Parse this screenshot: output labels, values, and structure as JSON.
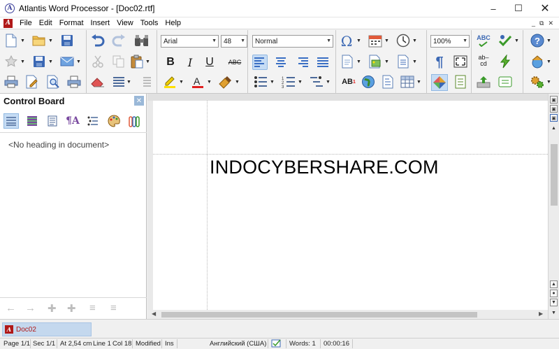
{
  "window": {
    "title": "Atlantis Word Processor - [Doc02.rtf]",
    "app_icon": "atlantis-logo-icon",
    "controls": {
      "minimize": "–",
      "maximize": "☐",
      "close": "✕"
    }
  },
  "menubar": {
    "items": [
      "File",
      "Edit",
      "Format",
      "Insert",
      "View",
      "Tools",
      "Help"
    ],
    "doc_icon_letter": "A",
    "mdi_controls": {
      "minimize": "_",
      "restore": "⧉",
      "close": "✕"
    }
  },
  "toolbar": {
    "font_name": "Arial",
    "font_size": "48",
    "style": "Normal",
    "zoom": "100%",
    "bold": "B",
    "italic": "I",
    "underline": "U",
    "strikethrough": "ABC",
    "omega": "Ω",
    "pilcrow": "¶",
    "spell": "ABC",
    "abcd_top": "ab–",
    "abcd_bottom": "cd",
    "superscript_label": "AB",
    "superscript_mark": "1",
    "icons": [
      "new-doc-icon",
      "open-folder-icon",
      "save-icon",
      "favorites-icon",
      "save-as-icon",
      "email-icon",
      "print-icon",
      "edit-doc-icon",
      "print-preview-icon",
      "undo-icon",
      "redo-icon",
      "find-icon",
      "cut-icon",
      "copy-icon",
      "paste-icon",
      "eraser-icon",
      "justify-icon",
      "indent-icon",
      "highlight-icon",
      "font-color-icon",
      "format-painter-icon",
      "bullet-list-icon",
      "numbered-list-icon",
      "multilevel-list-icon",
      "symbol-icon",
      "date-icon",
      "time-icon",
      "insert-page-icon",
      "insert-picture-icon",
      "insert-object-icon",
      "globe-link-icon",
      "bookmark-icon",
      "table-icon",
      "show-formatting-icon",
      "fullscreen-icon",
      "page-view-icon",
      "color-wheel-icon",
      "spellcheck-icon",
      "autocorrect-icon",
      "lightning-icon",
      "hyphenation-icon",
      "upload-icon",
      "ebook-icon",
      "help-icon",
      "web-home-icon",
      "settings-icon"
    ]
  },
  "control_board": {
    "title": "Control Board",
    "close": "✕",
    "empty_text": "<No heading in document>",
    "tools": [
      "outline-view-icon",
      "styles-list-icon",
      "doc-map-icon",
      "font-style-icon",
      "list-format-icon",
      "palette-icon",
      "clipboard-icon"
    ],
    "nav": [
      "←",
      "→",
      "✚",
      "✚",
      "≡",
      "≡"
    ]
  },
  "document": {
    "text": "INDOCYBERSHARE.COM"
  },
  "scrollbar": {
    "up": "▲",
    "down": "▼",
    "left": "◀",
    "right": "▶",
    "top_buttons": [
      "▣",
      "▣",
      "▣"
    ],
    "bottom_buttons": [
      "▲",
      "●",
      "▼"
    ]
  },
  "tabs": [
    {
      "label": "Doc02",
      "active": true
    }
  ],
  "statusbar": {
    "page": "Page 1/1",
    "section": "Sec 1/1",
    "at": "At 2,54 cm",
    "line": "Line 1",
    "col": "Col 18",
    "modified": "Modified",
    "insert": "Ins",
    "language": "Английский (США)",
    "words": "Words: 1",
    "time": "00:00:16"
  }
}
